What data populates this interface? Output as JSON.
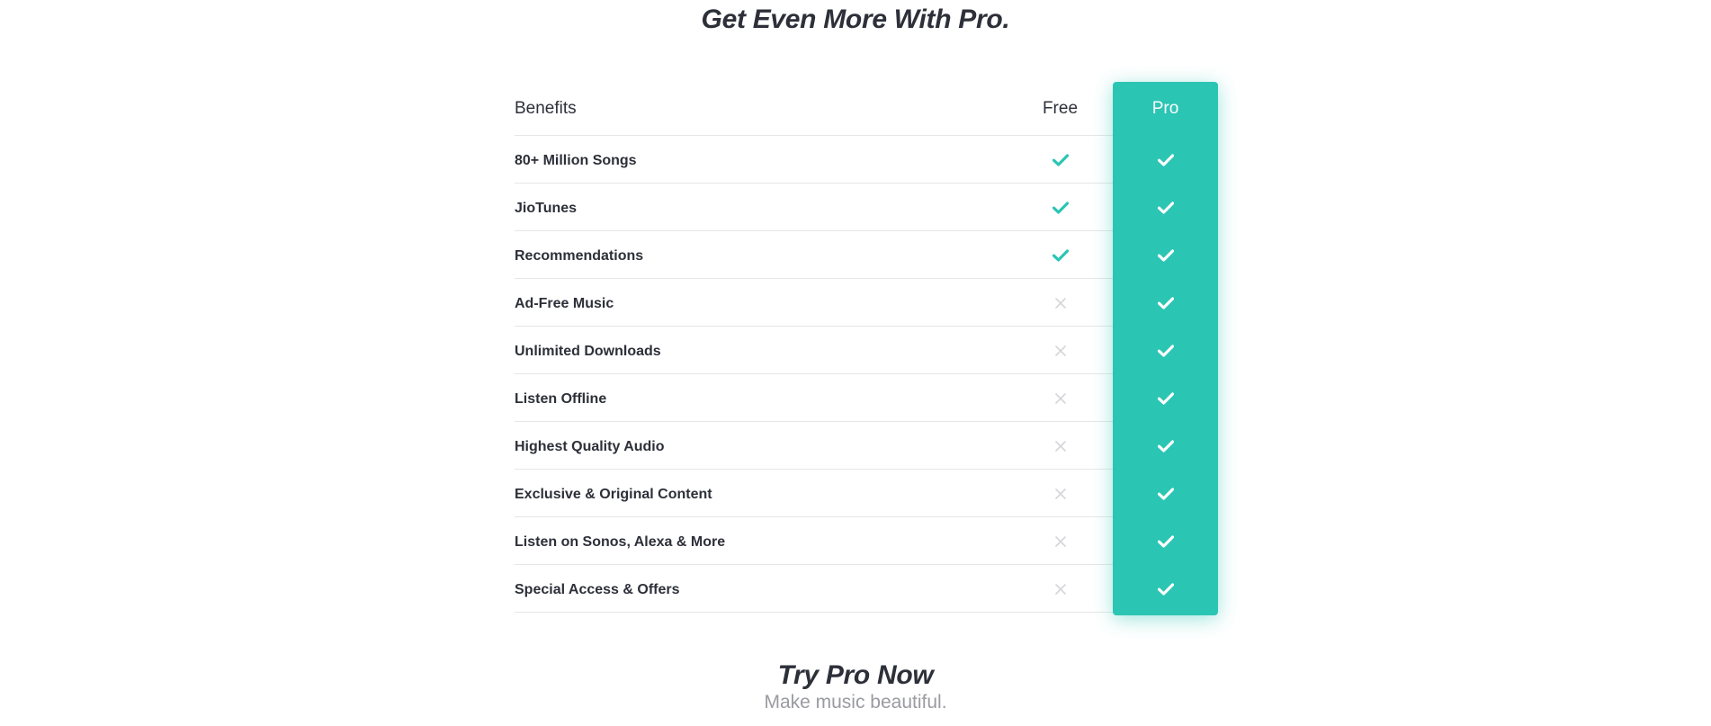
{
  "heading": "Get Even More With Pro.",
  "table": {
    "header": {
      "benefits_label": "Benefits",
      "free_label": "Free",
      "pro_label": "Pro"
    },
    "rows": [
      {
        "label": "80+ Million Songs",
        "free": true,
        "pro": true
      },
      {
        "label": "JioTunes",
        "free": true,
        "pro": true
      },
      {
        "label": "Recommendations",
        "free": true,
        "pro": true
      },
      {
        "label": "Ad-Free Music",
        "free": false,
        "pro": true
      },
      {
        "label": "Unlimited Downloads",
        "free": false,
        "pro": true
      },
      {
        "label": "Listen Offline",
        "free": false,
        "pro": true
      },
      {
        "label": "Highest Quality Audio",
        "free": false,
        "pro": true
      },
      {
        "label": "Exclusive & Original Content",
        "free": false,
        "pro": true
      },
      {
        "label": "Listen on Sonos, Alexa & More",
        "free": false,
        "pro": true
      },
      {
        "label": "Special Access & Offers",
        "free": false,
        "pro": true
      }
    ]
  },
  "cta": {
    "title": "Try Pro Now",
    "subtitle": "Make music beautiful."
  },
  "colors": {
    "accent": "#2bc5b4",
    "check_free": "#2bc5b4",
    "check_pro": "#ffffff",
    "cross": "#d5d6d9"
  },
  "icons": {
    "included": "check-icon",
    "excluded": "cross-icon"
  }
}
